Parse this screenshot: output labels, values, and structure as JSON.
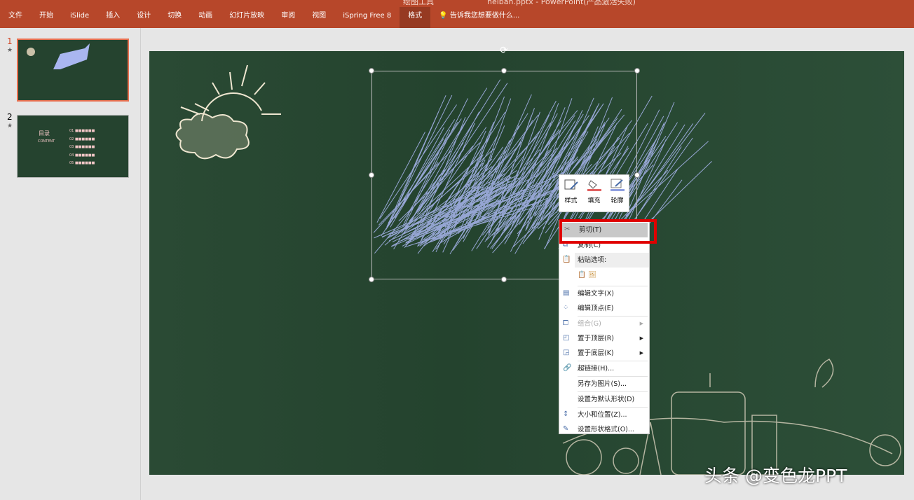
{
  "window": {
    "title": "heiban.pptx - PowerPoint(产品激活失败)",
    "context_group": "绘图工具"
  },
  "ribbon": {
    "tabs": [
      "文件",
      "开始",
      "iSlide",
      "插入",
      "设计",
      "切换",
      "动画",
      "幻灯片放映",
      "审阅",
      "视图",
      "iSpring Free 8",
      "格式"
    ],
    "active_tab": "格式",
    "tell_me": "告诉我您想要做什么..."
  },
  "thumbnails": [
    {
      "number": "1",
      "star": "★",
      "selected": true
    },
    {
      "number": "2",
      "star": "★",
      "selected": false,
      "title": "目录",
      "subtitle": "CONTENT",
      "items": [
        "01 ■■■■■■",
        "02 ■■■■■■",
        "03 ■■■■■■",
        "04 ■■■■■■",
        "05 ■■■■■■"
      ]
    }
  ],
  "mini_toolbar": [
    {
      "label": "样式",
      "icon": "shape-style-icon"
    },
    {
      "label": "填充",
      "icon": "fill-bucket-icon",
      "color": "#e06060"
    },
    {
      "label": "轮廓",
      "icon": "outline-pen-icon",
      "color": "#8f9fe0"
    }
  ],
  "context_menu": {
    "cut": "剪切(T)",
    "copy": "复制(C)",
    "paste_options": "粘贴选项:",
    "items": [
      {
        "label": "编辑文字(X)",
        "icon": "edit-text-icon"
      },
      {
        "label": "编辑顶点(E)",
        "icon": "edit-points-icon"
      },
      {
        "label": "组合(G)",
        "icon": "group-icon",
        "disabled": true,
        "submenu": true
      },
      {
        "label": "置于顶层(R)",
        "icon": "bring-front-icon",
        "submenu": true
      },
      {
        "label": "置于底层(K)",
        "icon": "send-back-icon",
        "submenu": true
      },
      {
        "label": "超链接(H)...",
        "icon": "hyperlink-icon"
      },
      {
        "label": "另存为图片(S)..."
      },
      {
        "label": "设置为默认形状(D)"
      },
      {
        "label": "大小和位置(Z)...",
        "icon": "size-position-icon"
      },
      {
        "label": "设置形状格式(O)...",
        "icon": "format-shape-icon"
      }
    ]
  },
  "scribble_color": "#a9b6f0",
  "watermark": "头条 @变色龙PPT"
}
